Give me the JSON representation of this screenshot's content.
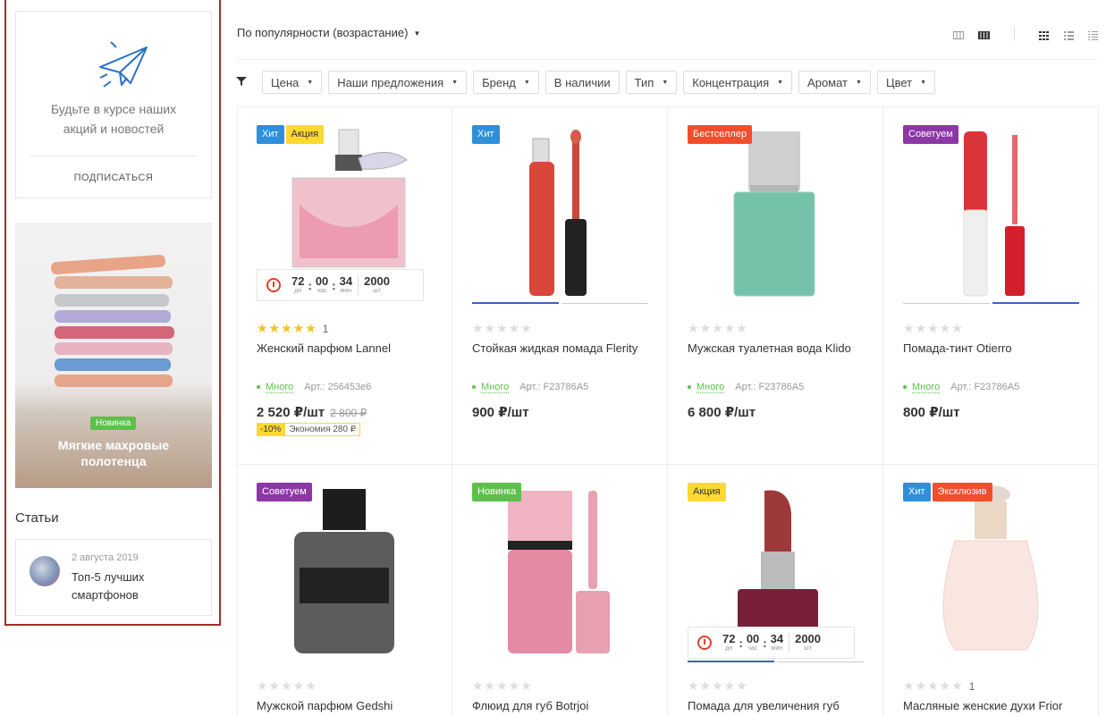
{
  "sidebar": {
    "subscribe_text": "Будьте в курсе наших акций и новостей",
    "subscribe_link": "ПОДПИСАТЬСЯ",
    "promo_badge": "Новинка",
    "promo_title": "Мягкие махровые полотенца",
    "articles_title": "Статьи",
    "article": {
      "date": "2 августа 2019",
      "title": "Топ-5 лучших смартфонов"
    }
  },
  "toolbar": {
    "sort_label": "По популярности (возрастание)",
    "view_icons": [
      "table-view-icon",
      "list-view-icon",
      "grid-icon",
      "list-icon",
      "compact-list-icon"
    ]
  },
  "filters": [
    "Цена",
    "Наши предложения",
    "Бренд",
    "В наличии",
    "Тип",
    "Концентрация",
    "Аромат",
    "Цвет"
  ],
  "timer_units": {
    "days": "дн",
    "hours": "час",
    "minutes": "мин",
    "pieces": "шт"
  },
  "products": [
    {
      "badges": [
        "Хит",
        "Акция"
      ],
      "rating": 5,
      "reviews": "1",
      "name": "Женский парфюм Lannel",
      "stock": "Много",
      "sku": "Арт.: 256453e6",
      "price": "2 520 ₽/шт",
      "old_price": "2 800 ₽",
      "discount": "-10%",
      "economy": "Экономия 280 ₽",
      "timer": {
        "days": "72",
        "hours": "00",
        "minutes": "34",
        "pieces": "2000"
      }
    },
    {
      "badges": [
        "Хит"
      ],
      "rating": 0,
      "name": "Стойкая жидкая помада Flerity",
      "stock": "Много",
      "sku": "Арт.: F23786A5",
      "price": "900 ₽/шт"
    },
    {
      "badges": [
        "Бестселлер"
      ],
      "rating": 0,
      "name": "Мужская туалетная вода Klido",
      "stock": "Много",
      "sku": "Арт.: F23786A5",
      "price": "6 800 ₽/шт"
    },
    {
      "badges": [
        "Советуем"
      ],
      "rating": 0,
      "name": "Помада-тинт Otierro",
      "stock": "Много",
      "sku": "Арт.: F23786A5",
      "price": "800 ₽/шт"
    },
    {
      "badges": [
        "Советуем"
      ],
      "rating": 0,
      "name": "Мужской парфюм Gedshi"
    },
    {
      "badges": [
        "Новинка"
      ],
      "rating": 0,
      "name": "Флюид для губ Botrjoi"
    },
    {
      "badges": [
        "Акция"
      ],
      "rating": 0,
      "name": "Помада для увеличения губ",
      "timer": {
        "days": "72",
        "hours": "00",
        "minutes": "34",
        "pieces": "2000"
      }
    },
    {
      "badges": [
        "Хит",
        "Эксклюзив"
      ],
      "rating": 0,
      "reviews": "1",
      "name": "Масляные женские духи Frior"
    }
  ],
  "colors": {
    "accent_red": "#a52a2a",
    "badge_hit": "#2e8fda",
    "badge_sale": "#ffd92f",
    "badge_bestseller": "#f24e2c",
    "badge_recommend": "#8d36a6",
    "badge_new": "#5ec04b",
    "in_stock": "#5ec04b"
  }
}
